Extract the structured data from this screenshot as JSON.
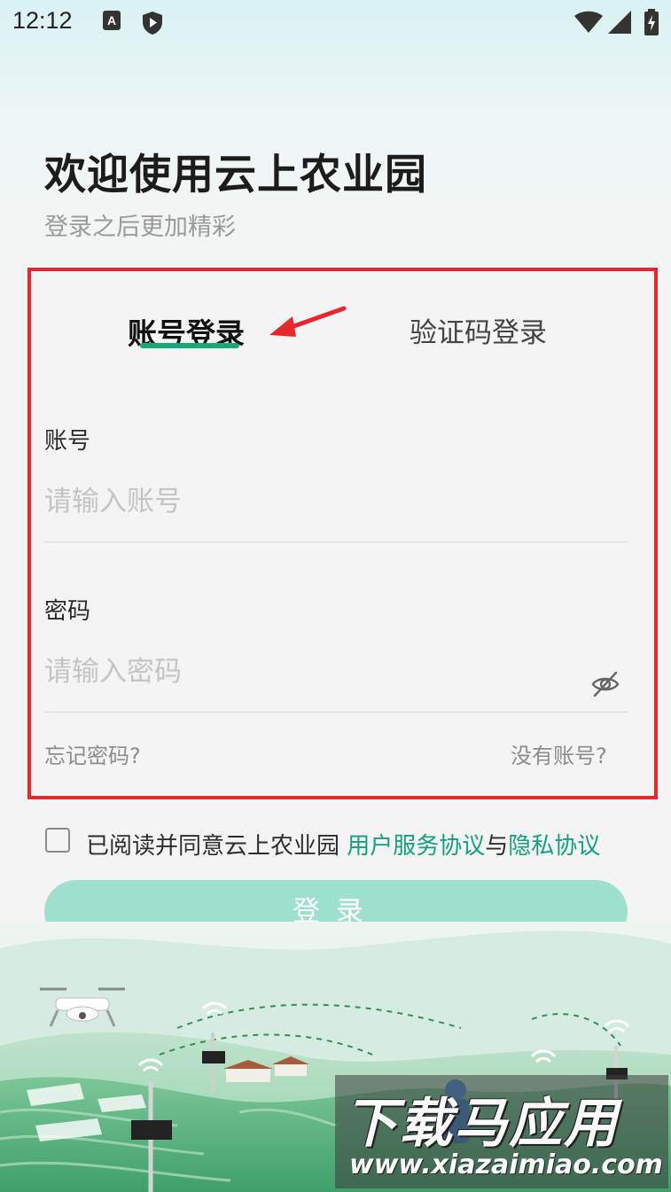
{
  "status_bar": {
    "time": "12:12",
    "left_icons": [
      "a-icon",
      "shield-play-icon"
    ],
    "right_icons": [
      "wifi-icon",
      "signal-icon",
      "battery-charging-icon"
    ]
  },
  "header": {
    "title": "欢迎使用云上农业园",
    "subtitle": "登录之后更加精彩"
  },
  "tabs": [
    {
      "label": "账号登录",
      "active": true
    },
    {
      "label": "验证码登录",
      "active": false
    }
  ],
  "form": {
    "account_label": "账号",
    "account_placeholder": "请输入账号",
    "account_value": "",
    "password_label": "密码",
    "password_placeholder": "请输入密码",
    "password_value": "",
    "forgot_password": "忘记密码?",
    "no_account": "没有账号?"
  },
  "agreement": {
    "checked": false,
    "prefix": "已阅读并同意云上农业园 ",
    "user_agreement": "用户服务协议",
    "joiner": "与",
    "privacy_policy": "隐私协议"
  },
  "login_button": "登录",
  "watermark": {
    "main": "下载马应用",
    "url": "www.xiazaimiao.com"
  },
  "colors": {
    "accent": "#14a07a",
    "button_bg": "#9fe0cd",
    "annotation_red": "#e8262d"
  }
}
